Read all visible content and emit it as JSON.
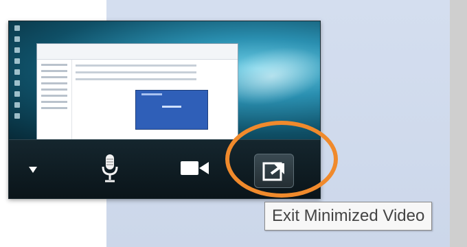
{
  "tooltip": {
    "text": "Exit Minimized Video"
  },
  "controls": {
    "menu_icon": "triangle-down-icon",
    "mic_icon": "microphone-icon",
    "video_icon": "video-camera-icon",
    "exit_icon": "exit-minimized-video-icon"
  },
  "colors": {
    "highlight_ring": "#f08a2c",
    "taskbar": "#0a1419",
    "background_panel": "#ccd7ea"
  }
}
